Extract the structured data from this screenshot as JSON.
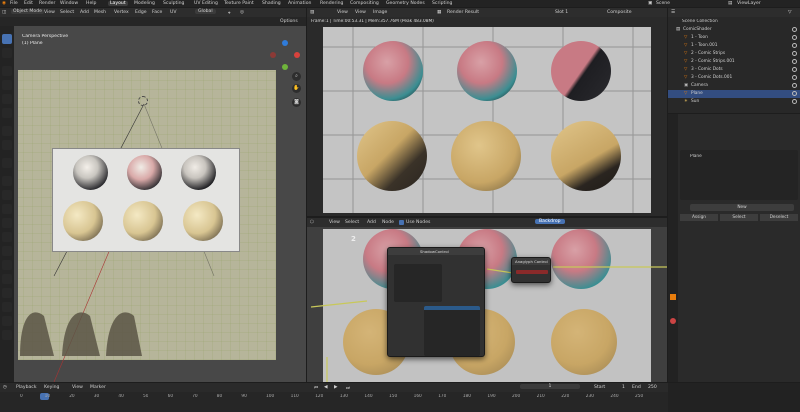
{
  "topbar": {
    "menus": [
      "File",
      "Edit",
      "Render",
      "Window",
      "Help"
    ],
    "workspaces": [
      "Layout",
      "Modeling",
      "Sculpting",
      "UV Editing",
      "Texture Paint",
      "Shading",
      "Animation",
      "Rendering",
      "Compositing",
      "Geometry Nodes",
      "Scripting"
    ],
    "active_workspace": "Layout",
    "scene_label": "Scene",
    "viewlayer_label": "ViewLayer"
  },
  "viewport": {
    "mode": "Object Mode",
    "menus": [
      "View",
      "Select",
      "Add",
      "Mesh",
      "Vertex",
      "Edge",
      "Face",
      "UV"
    ],
    "transform": "Global",
    "options": "Options",
    "overlay_title": "Camera Perspective",
    "overlay_subtitle": "(1) Plane",
    "gizmo_labels": [
      "X",
      "Y",
      "Z"
    ]
  },
  "render": {
    "menus": [
      "View",
      "View",
      "Image"
    ],
    "image_name": "Render Result",
    "slot": "Slot 1",
    "layer": "Composite",
    "info": "Frame:1 | Time:00:53.31 | Mem:357.76M (Peak 483.08M)"
  },
  "compositor": {
    "menus": [
      "View",
      "Select",
      "Add",
      "Node"
    ],
    "use_nodes_label": "Use Nodes",
    "backdrop_label": "Backdrop",
    "frame_label": "2",
    "nodes": {
      "shadow": {
        "title": "ShadowControl"
      },
      "anaglyph": {
        "title": "Anaglyph Control"
      }
    }
  },
  "outliner": {
    "title": "Scene Collection",
    "items": [
      {
        "label": "ComicShader",
        "indent": 0
      },
      {
        "label": "1 - Toon",
        "indent": 1
      },
      {
        "label": "1 - Toon.001",
        "indent": 1
      },
      {
        "label": "2 - Comic Strips",
        "indent": 1
      },
      {
        "label": "2 - Comic Strips.001",
        "indent": 1
      },
      {
        "label": "3 - Comic Dots",
        "indent": 1
      },
      {
        "label": "3 - Comic Dots.001",
        "indent": 1
      },
      {
        "label": "Camera",
        "indent": 1
      },
      {
        "label": "Plane",
        "indent": 1,
        "selected": true
      },
      {
        "label": "Sun",
        "indent": 1
      }
    ]
  },
  "properties": {
    "material_slot": "Plane",
    "new_label": "New",
    "assign_label": "Assign",
    "select_label": "Select",
    "deselect_label": "Deselect"
  },
  "timeline": {
    "menus": [
      "Playback",
      "Keying",
      "View",
      "Marker"
    ],
    "current_frame": "1",
    "start_label": "Start",
    "start_value": "1",
    "end_label": "End",
    "end_value": "250",
    "ticks": [
      "0",
      "10",
      "20",
      "30",
      "40",
      "50",
      "60",
      "70",
      "80",
      "90",
      "100",
      "110",
      "120",
      "130",
      "140",
      "150",
      "160",
      "170",
      "180",
      "190",
      "200",
      "210",
      "220",
      "230",
      "240",
      "250"
    ]
  },
  "colors": {
    "accent": "#4772b3",
    "sphere_teal": "#3b8e92",
    "sphere_pink": "#c87a84",
    "sphere_yellow": "#c8a665",
    "selection": "#334d80"
  }
}
